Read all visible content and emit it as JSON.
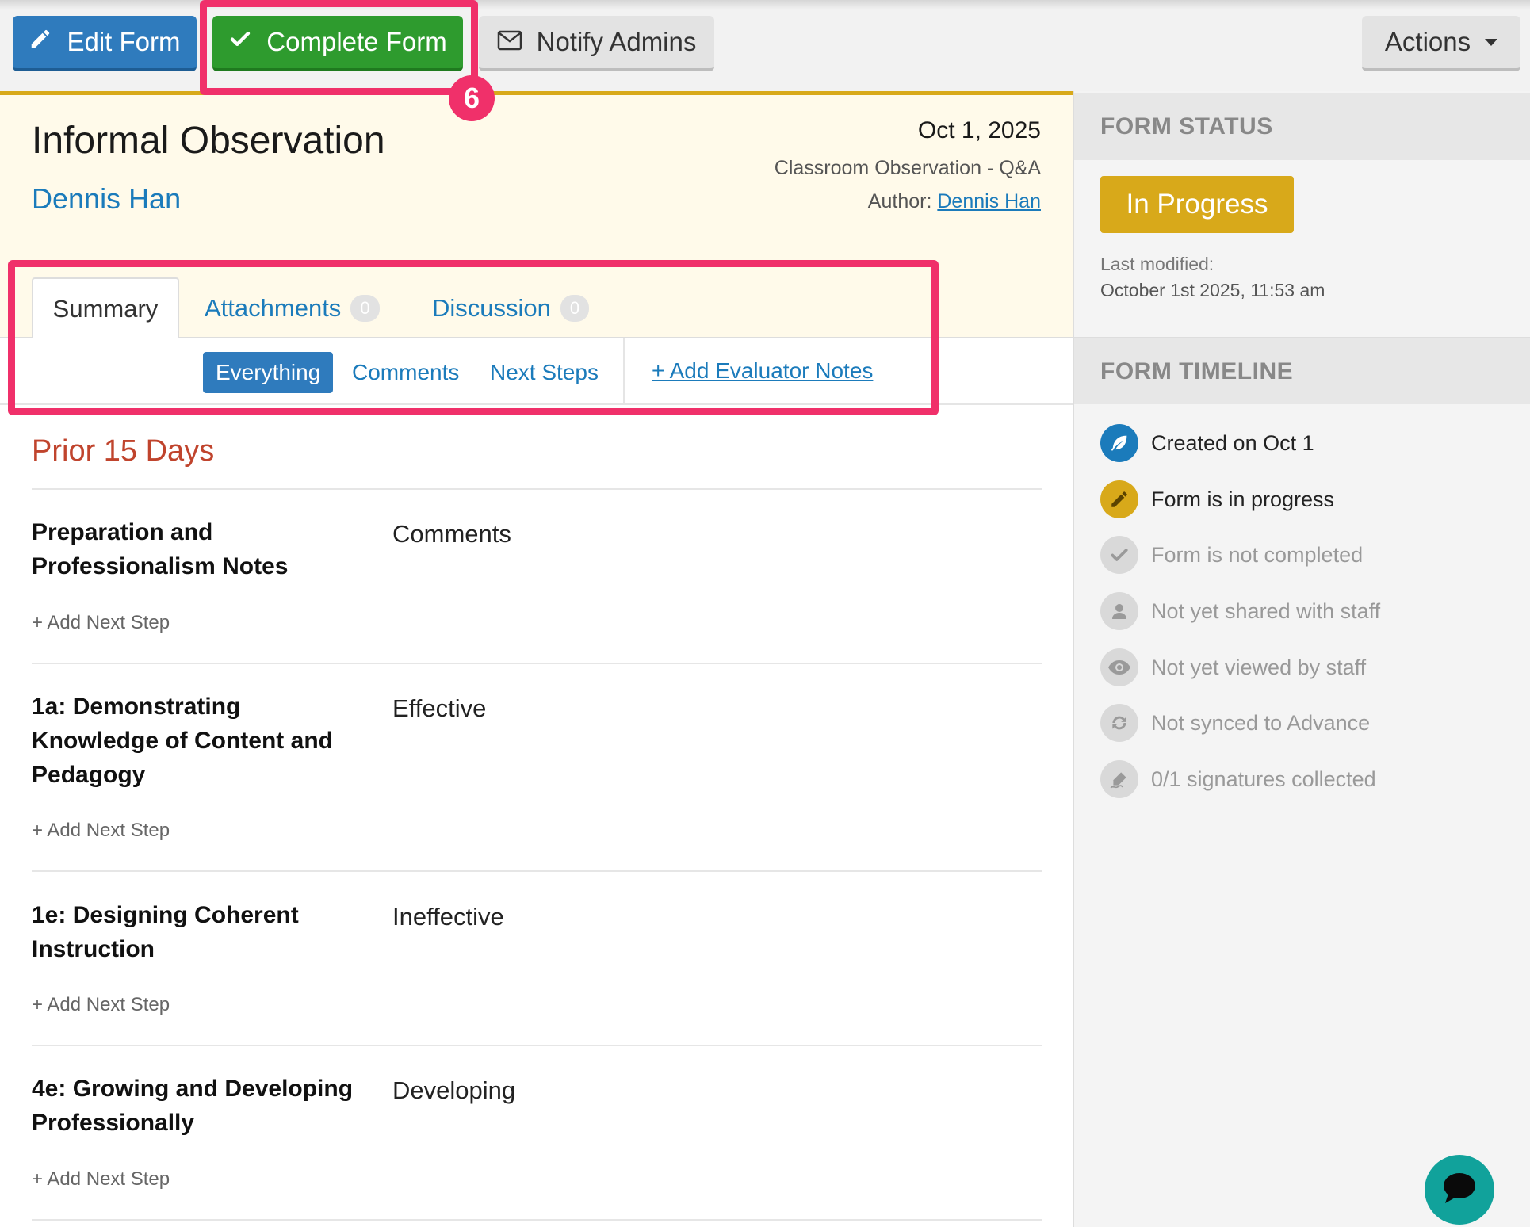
{
  "toolbar": {
    "edit_label": "Edit Form",
    "complete_label": "Complete Form",
    "notify_label": "Notify Admins",
    "actions_label": "Actions"
  },
  "annotation": {
    "step_number": "6"
  },
  "header": {
    "title": "Informal Observation",
    "subject": "Dennis Han",
    "date": "Oct 1, 2025",
    "form_type": "Classroom Observation - Q&A",
    "author_label": "Author:",
    "author_name": "Dennis Han"
  },
  "tabs": [
    {
      "label": "Summary",
      "count": ""
    },
    {
      "label": "Attachments",
      "count": "0"
    },
    {
      "label": "Discussion",
      "count": "0"
    }
  ],
  "filters": {
    "everything": "Everything",
    "comments": "Comments",
    "next_steps": "Next Steps",
    "add_notes": "+ Add Evaluator Notes"
  },
  "section": {
    "title": "Prior 15 Days"
  },
  "items": [
    {
      "title": "Preparation and Professionalism Notes",
      "value": "Comments",
      "next_step": "+ Add Next Step"
    },
    {
      "title": "1a: Demonstrating Knowledge of Content and Pedagogy",
      "value": "Effective",
      "next_step": "+ Add Next Step"
    },
    {
      "title": "1e: Designing Coherent Instruction",
      "value": "Ineffective",
      "next_step": "+ Add Next Step"
    },
    {
      "title": "4e: Growing and Developing Professionally",
      "value": "Developing",
      "next_step": "+ Add Next Step"
    }
  ],
  "sidebar": {
    "status_heading": "FORM STATUS",
    "status": "In Progress",
    "last_modified_label": "Last modified:",
    "last_modified_value": "October 1st 2025, 11:53 am",
    "timeline_heading": "FORM TIMELINE",
    "timeline": [
      {
        "label": "Created on Oct 1",
        "icon": "feather-icon"
      },
      {
        "label": "Form is in progress",
        "icon": "pencil-icon"
      },
      {
        "label": "Form is not completed",
        "icon": "check-icon"
      },
      {
        "label": "Not yet shared with staff",
        "icon": "person-icon"
      },
      {
        "label": "Not yet viewed by staff",
        "icon": "eye-icon"
      },
      {
        "label": "Not synced to Advance",
        "icon": "sync-icon"
      },
      {
        "label": "0/1 signatures collected",
        "icon": "signature-icon"
      }
    ]
  },
  "colors": {
    "primary": "#2f7bbd",
    "success": "#2e9b2e",
    "warning": "#d8a91a",
    "highlight": "#f0306a",
    "section_title": "#c0442d",
    "chat": "#11a29b"
  }
}
